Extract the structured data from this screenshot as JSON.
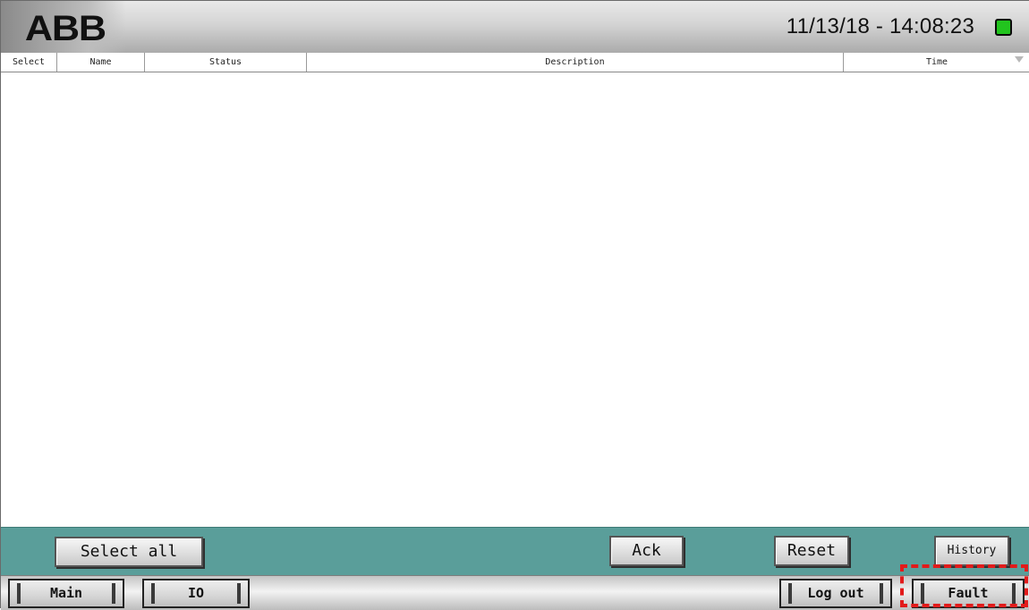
{
  "header": {
    "logo_letters": [
      "A",
      "B",
      "B"
    ],
    "datetime": "11/13/18 - 14:08:23",
    "status_color": "#22c41e"
  },
  "table": {
    "columns": [
      "Select",
      "Name",
      "Status",
      "Description",
      "Time"
    ],
    "rows": []
  },
  "actions": {
    "select_all": "Select all",
    "ack": "Ack",
    "reset": "Reset",
    "history": "History"
  },
  "nav": {
    "main": "Main",
    "io": "IO",
    "logout": "Log out",
    "fault": "Fault"
  },
  "colors": {
    "action_bar": "#5a9e9a",
    "highlight": "#e21b1b"
  }
}
